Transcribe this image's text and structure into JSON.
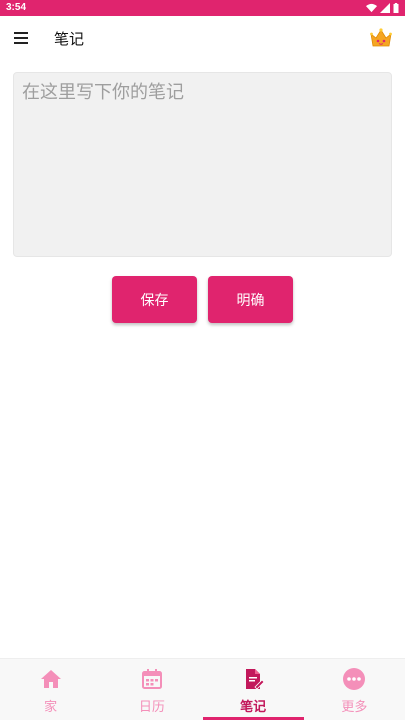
{
  "status_bar": {
    "time": "3:54"
  },
  "app_bar": {
    "title": "笔记"
  },
  "note": {
    "placeholder": "在这里写下你的笔记",
    "value": ""
  },
  "buttons": {
    "save_label": "保存",
    "clear_label": "明确"
  },
  "bottom_nav": {
    "items": [
      {
        "label": "家",
        "icon": "home-icon",
        "active": false
      },
      {
        "label": "日历",
        "icon": "calendar-icon",
        "active": false
      },
      {
        "label": "笔记",
        "icon": "note-icon",
        "active": true
      },
      {
        "label": "更多",
        "icon": "more-icon",
        "active": false
      }
    ]
  },
  "colors": {
    "primary": "#e0246e",
    "nav_inactive": "#f48fb9",
    "nav_active": "#c2185b",
    "note_bg": "#f1f1f1"
  }
}
